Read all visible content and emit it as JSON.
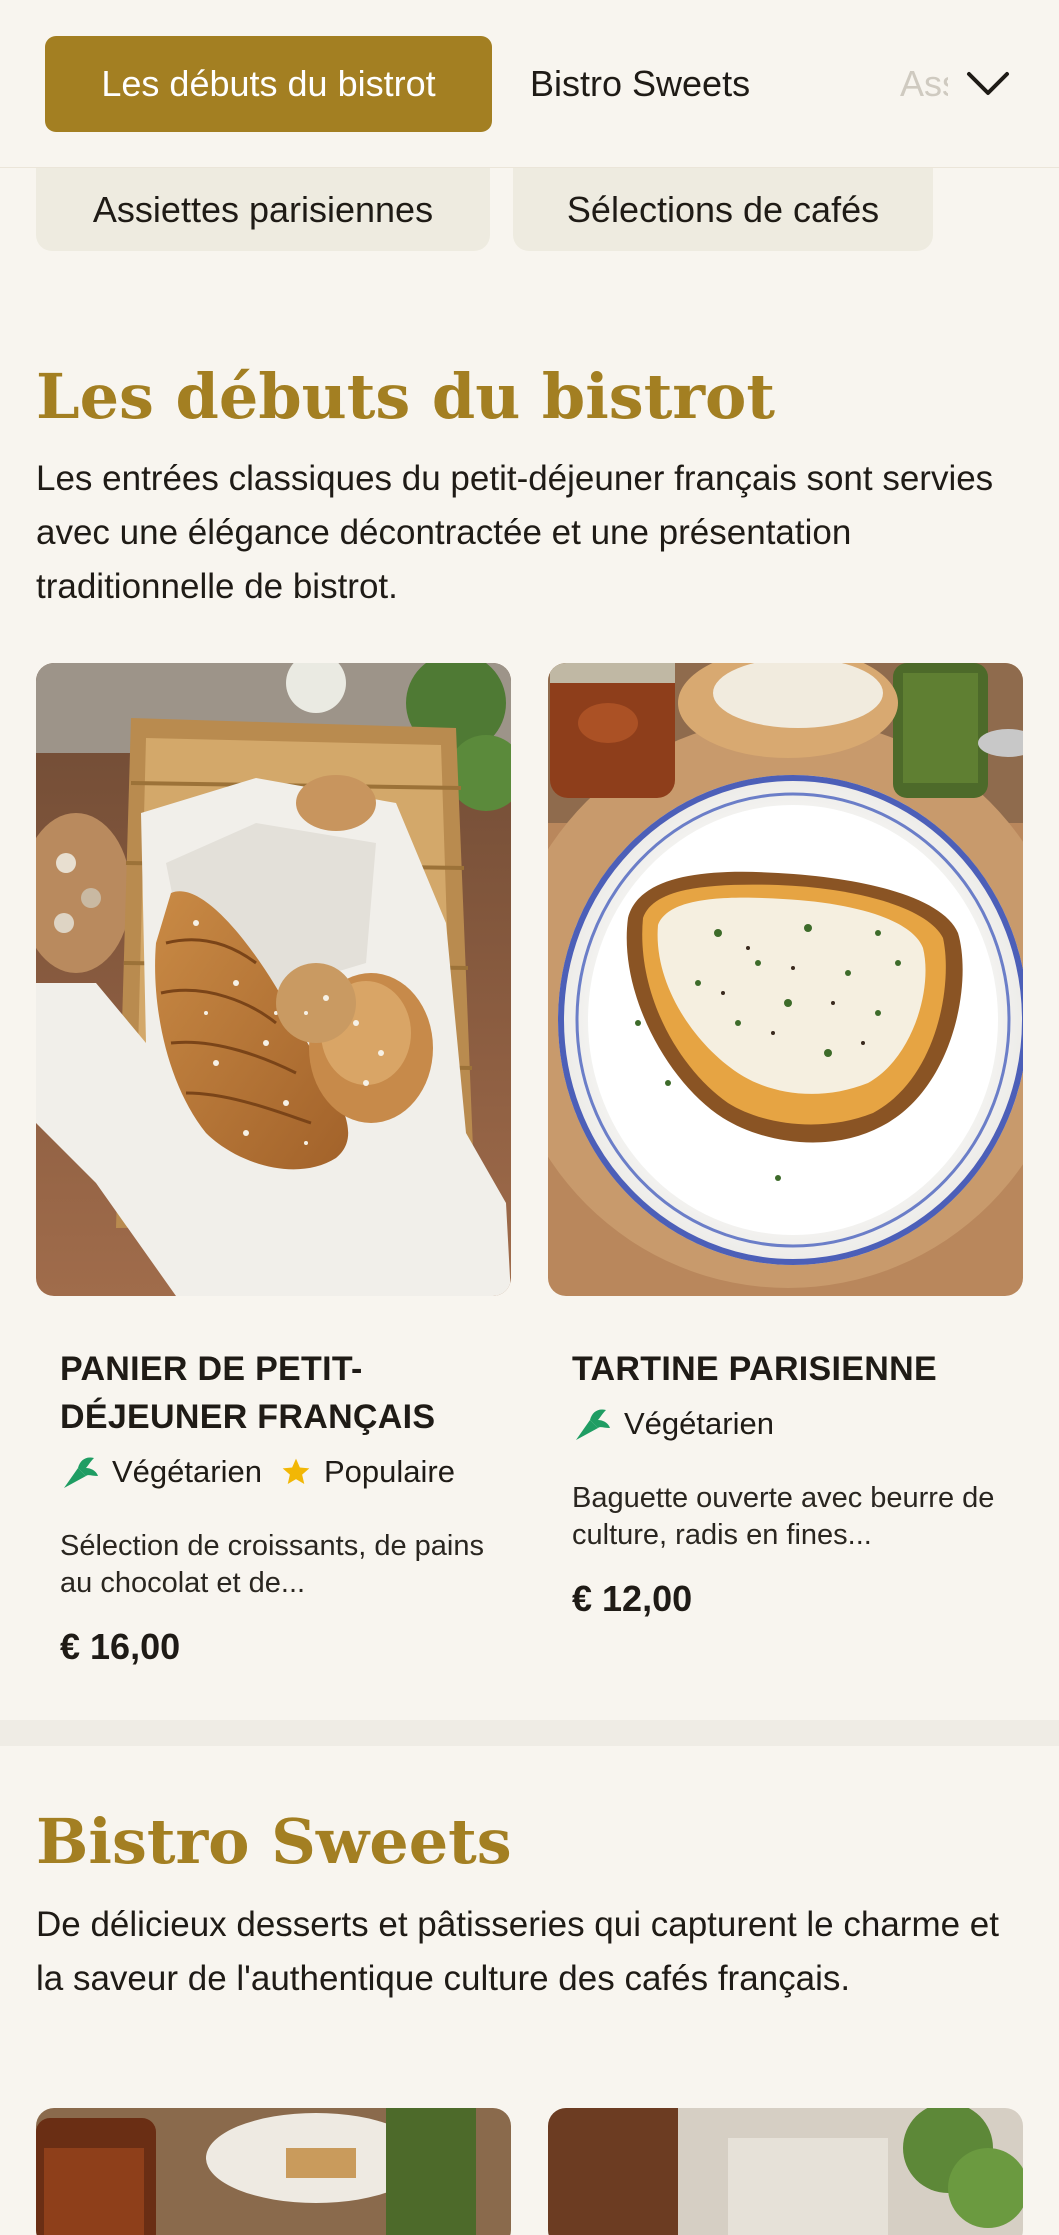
{
  "nav": {
    "active_tab": "Les débuts du bistrot",
    "tab_2": "Bistro Sweets",
    "tab_3_partial": "Assiettes parisiennes",
    "chevron_icon": "chevron-down-icon"
  },
  "chips": {
    "chip_1": "Assiettes parisiennes",
    "chip_2": "Sélections de cafés"
  },
  "section_1": {
    "title": "Les débuts du bistrot",
    "description": "Les entrées classiques du petit-déjeuner français sont servies avec une élégance décontractée et une présentation traditionnelle de bistrot.",
    "items": [
      {
        "name": "PANIER DE PETIT-DÉJEUNER FRANÇAIS",
        "tag_veg": "Végétarien",
        "tag_popular": "Populaire",
        "description": "Sélection de croissants, de pains au chocolat et de...",
        "price": "€ 16,00"
      },
      {
        "name": "TARTINE PARISIENNE",
        "tag_veg": "Végétarien",
        "description": "Baguette ouverte avec beurre de culture, radis en fines...",
        "price": "€ 12,00"
      }
    ]
  },
  "section_2": {
    "title": "Bistro Sweets",
    "description": "De délicieux desserts et pâtisseries qui capturent le charme et la saveur de l'authentique culture des cafés français."
  },
  "colors": {
    "accent": "#a37f22",
    "background": "#f8f5ef",
    "veg_green": "#1f9d63",
    "star_yellow": "#f2b705"
  }
}
